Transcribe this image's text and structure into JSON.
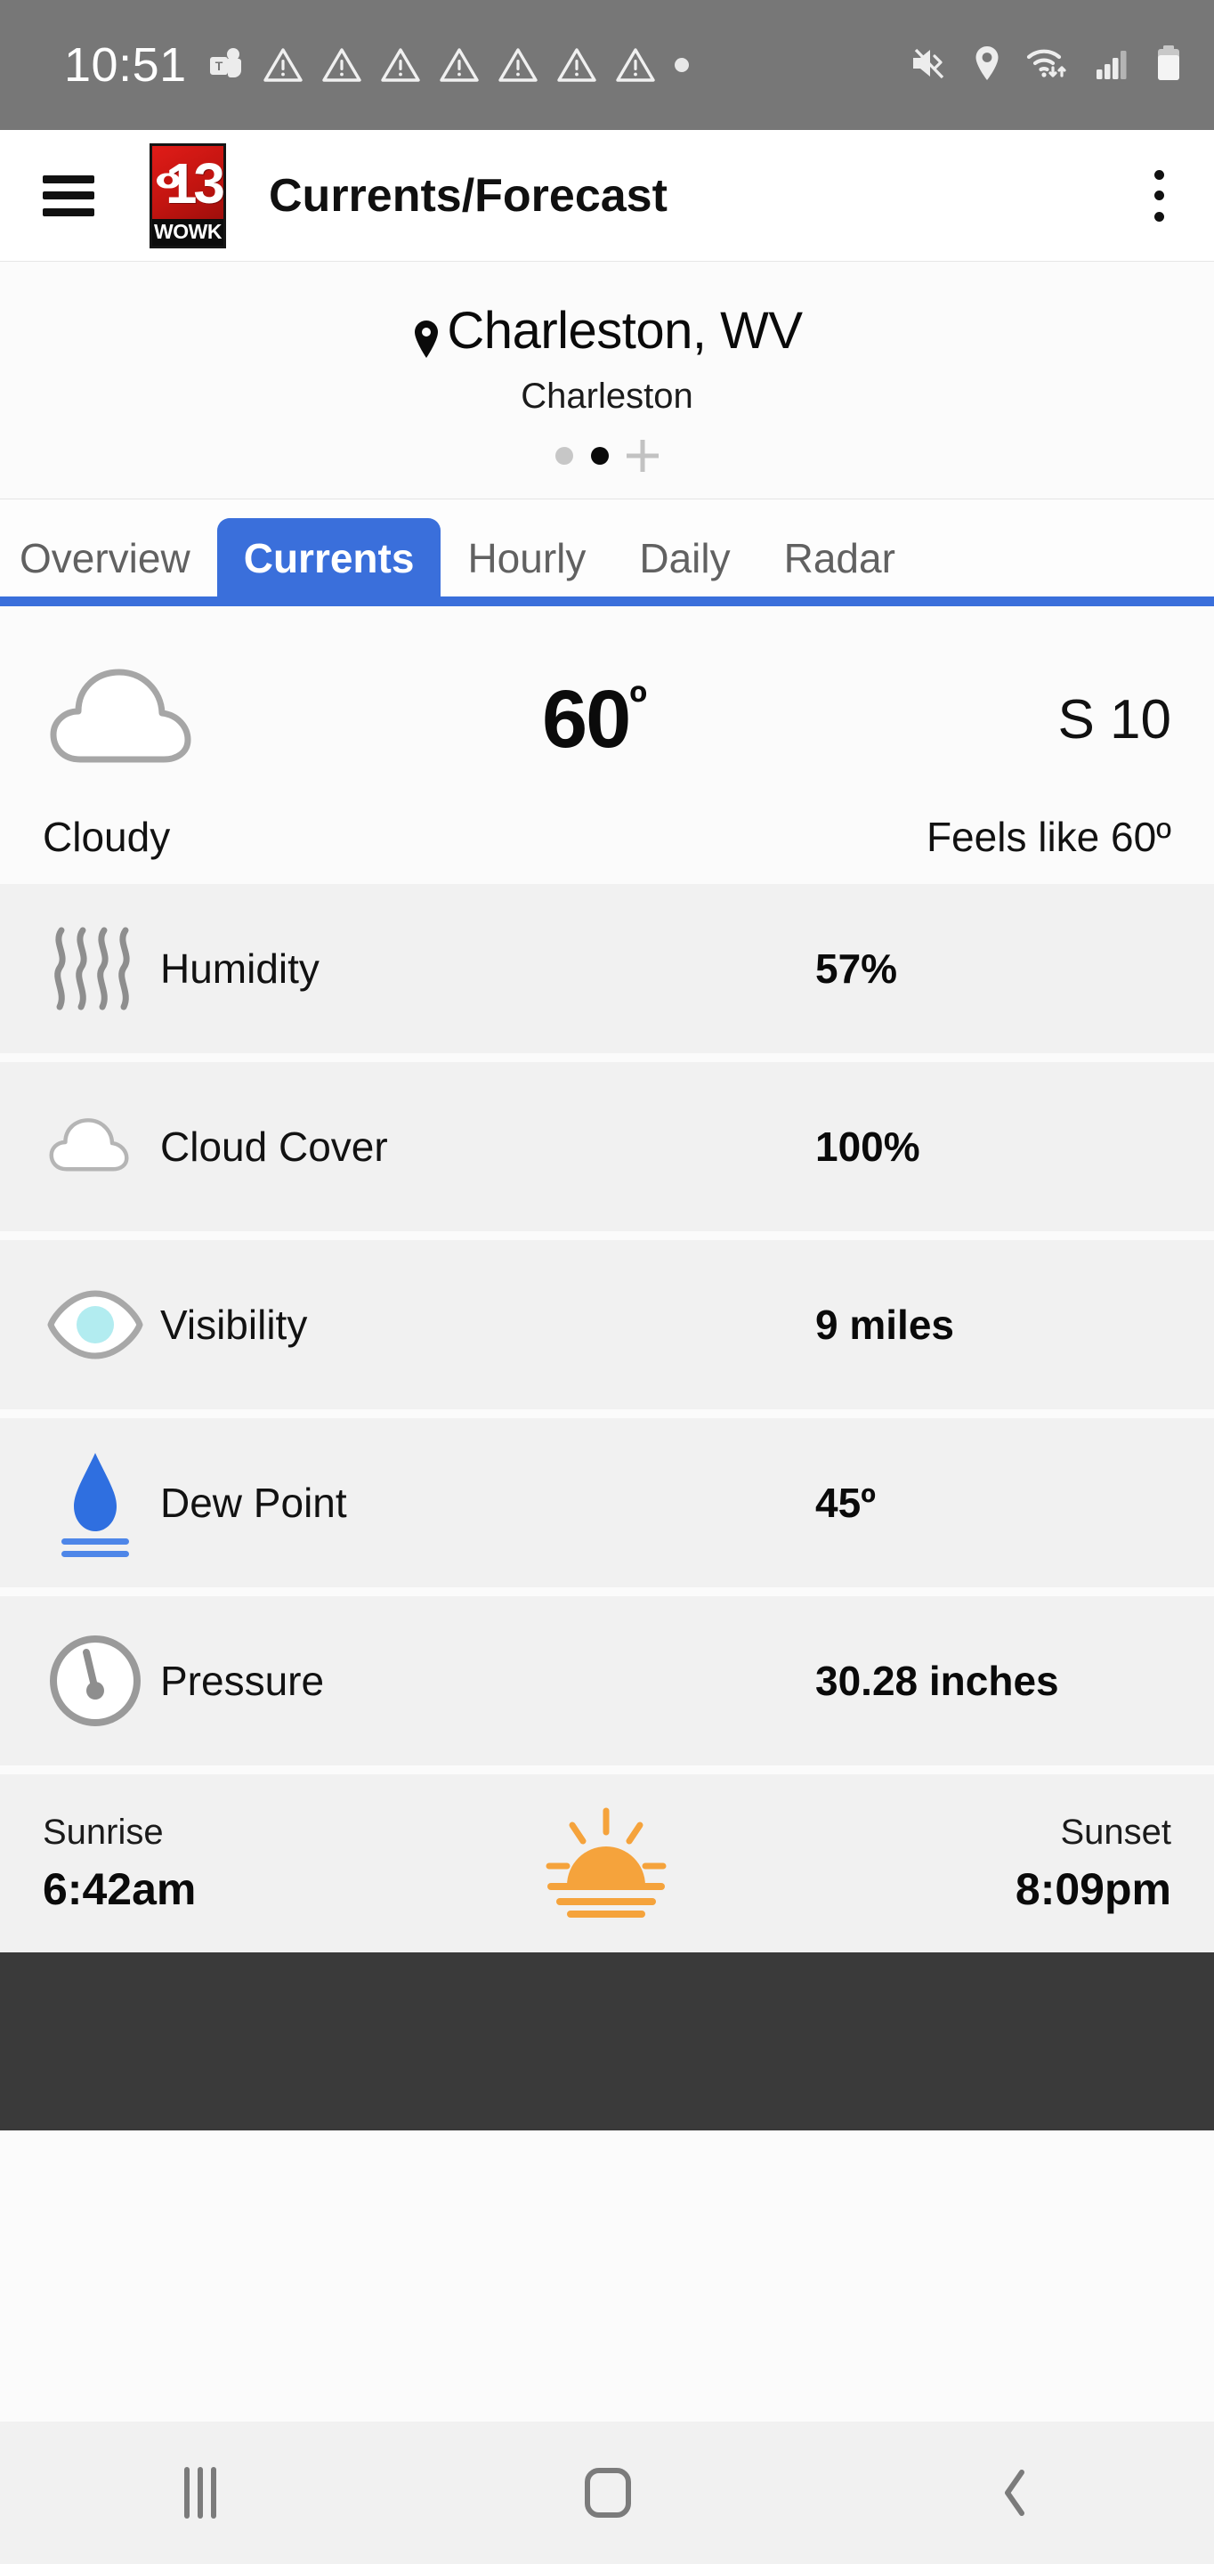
{
  "statusbar": {
    "time": "10:51",
    "icons_left": [
      "teams-icon",
      "warning-triangle-icon",
      "warning-triangle-icon",
      "warning-triangle-icon",
      "warning-triangle-icon",
      "warning-triangle-icon",
      "warning-triangle-icon",
      "warning-triangle-icon",
      "dot-indicator"
    ],
    "icons_right": [
      "mute-icon",
      "location-icon",
      "wifi-icon",
      "cellular-signal-icon",
      "battery-icon"
    ]
  },
  "appbar": {
    "menu_icon": "hamburger-menu-icon",
    "logo_number": "13",
    "logo_callsign": "WOWK",
    "title": "Currents/Forecast",
    "overflow_icon": "kebab-menu-icon"
  },
  "location": {
    "pin_icon": "location-pin-icon",
    "name": "Charleston, WV",
    "sub": "Charleston",
    "dots": [
      "inactive",
      "active"
    ],
    "add_label": "+"
  },
  "tabs": [
    {
      "label": "Overview",
      "active": false
    },
    {
      "label": "Currents",
      "active": true
    },
    {
      "label": "Hourly",
      "active": false
    },
    {
      "label": "Daily",
      "active": false
    },
    {
      "label": "Radar",
      "active": false
    }
  ],
  "current": {
    "condition_icon": "cloud-icon",
    "temperature": "60",
    "degree": "º",
    "wind": "S 10",
    "description": "Cloudy",
    "feels_like": "Feels like 60º"
  },
  "details": [
    {
      "icon": "humidity-waves-icon",
      "label": "Humidity",
      "value": "57%"
    },
    {
      "icon": "cloud-icon",
      "label": "Cloud Cover",
      "value": "100%"
    },
    {
      "icon": "eye-icon",
      "label": "Visibility",
      "value": "9 miles"
    },
    {
      "icon": "water-droplet-icon",
      "label": "Dew Point",
      "value": "45º"
    },
    {
      "icon": "pressure-gauge-icon",
      "label": "Pressure",
      "value": "30.28 inches"
    }
  ],
  "sun": {
    "sunrise_label": "Sunrise",
    "sunrise_time": "6:42am",
    "sun_icon": "sunrise-sun-icon",
    "sunset_label": "Sunset",
    "sunset_time": "8:09pm"
  },
  "navbar": {
    "recents_icon": "recents-icon",
    "home_icon": "home-icon",
    "back_icon": "back-icon"
  },
  "colors": {
    "accent_blue": "#3a6fdb",
    "statusbar_gray": "#777777",
    "row_gray": "#f1f1f1",
    "sun_orange": "#f5a33c",
    "dew_blue": "#2f6fe0",
    "eye_cyan": "#b2ecf0",
    "ad_dark": "#3a3a3a"
  }
}
